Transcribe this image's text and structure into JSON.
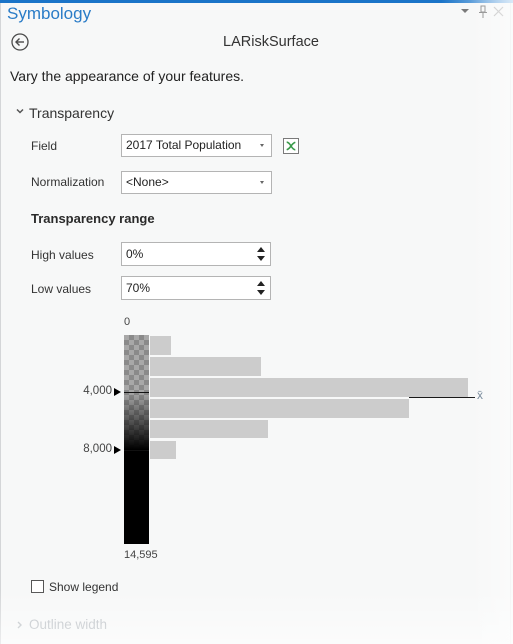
{
  "window": {
    "title": "Symbology",
    "icons": [
      "options-menu-icon",
      "pin-icon",
      "close-icon"
    ]
  },
  "header": {
    "back_icon": "back-arrow-icon",
    "layer_name": "LARiskSurface"
  },
  "description": "Vary the appearance of your features.",
  "transparency": {
    "section_label": "Transparency",
    "expanded": true,
    "field": {
      "label": "Field",
      "value": "2017 Total Population",
      "expression_icon": "expression-builder-icon"
    },
    "normalization": {
      "label": "Normalization",
      "value": "<None>"
    },
    "range_title": "Transparency range",
    "high_values": {
      "label": "High values",
      "value": "0%"
    },
    "low_values": {
      "label": "Low values",
      "value": "70%"
    }
  },
  "show_legend": {
    "label": "Show legend",
    "checked": false
  },
  "outline_width": {
    "section_label": "Outline width",
    "expanded": false
  },
  "colors": {
    "title_blue": "#2a7cc7",
    "accent_strip": "#1a74c8",
    "expression_icon_green": "#3a9a4a",
    "histogram_bar": "#cccccc",
    "ramp_color": "#000000"
  },
  "chart_data": {
    "type": "bar",
    "orientation": "horizontal-histogram",
    "title": "",
    "field": "2017 Total Population",
    "range": [
      0,
      14595
    ],
    "min_label": "0",
    "max_label": "14,595",
    "bin_count": 10,
    "relative_frequency_percent": [
      6.6,
      34.9,
      100,
      81.4,
      37.1,
      8.2,
      0,
      0,
      0,
      0
    ],
    "handles": [
      {
        "value": 4000,
        "label": "4,000",
        "transparency_percent": 70
      },
      {
        "value": 8000,
        "label": "8,000",
        "transparency_percent": 0
      }
    ],
    "mean": 4340,
    "mean_label": "x̄",
    "grid": false,
    "legend": "none"
  }
}
